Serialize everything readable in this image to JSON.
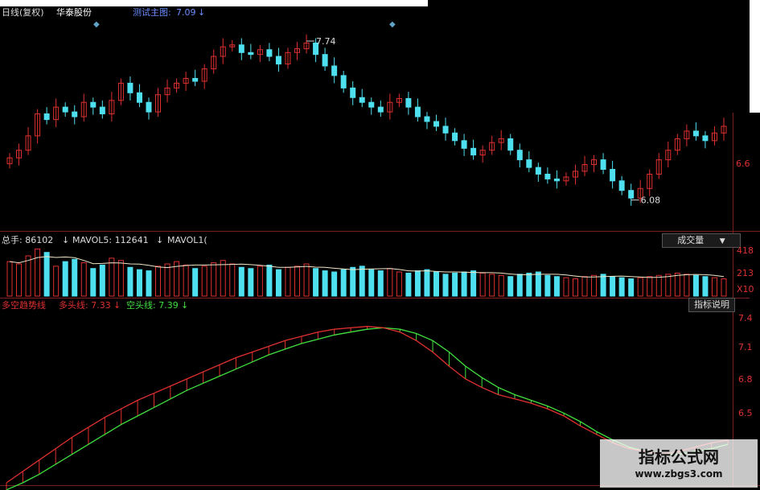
{
  "header": {
    "period": "日线(复权)",
    "stock": "华泰股份",
    "indicator_label": "测试主图:",
    "indicator_value": "7.09",
    "arrow": "↓"
  },
  "price_panel": {
    "high_label": "7.74",
    "low_label": "6.08",
    "right_axis": "6.6"
  },
  "volume_panel": {
    "vol_label": "总手: 86102",
    "mavol5_label": "MAVOL5: 112641",
    "mavol10_label": "MAVOL1(",
    "arrow": "↓",
    "selector": "成交量",
    "selector_caret": "▼",
    "axis": [
      "418",
      "213",
      "X10"
    ]
  },
  "indicator_panel": {
    "name": "多空趋势线",
    "long_label": "多头线: 7.33",
    "short_label": "空头线: 7.39",
    "arrow": "↓",
    "help_button": "指标说明",
    "axis": [
      "7.4",
      "7.1",
      "6.8",
      "6.5"
    ]
  },
  "watermark": {
    "line1": "指标公式网",
    "line2": "www.zbgs3.com"
  },
  "colors": {
    "up": "#e03030",
    "down": "#4fe0f0",
    "long_line": "#e03030",
    "short_line": "#40e040",
    "grid": "#7a1f1f"
  },
  "chart_data": [
    {
      "type": "candlestick",
      "title": "华泰股份 日线(复权)",
      "y_axis_label_printed": "6.6",
      "ylim": [
        5.9,
        7.9
      ],
      "annotations": [
        {
          "label": "7.74",
          "value": 7.74
        },
        {
          "label": "6.08",
          "value": 6.08
        }
      ],
      "close": [
        6.52,
        6.6,
        6.75,
        6.98,
        6.92,
        7.05,
        7.0,
        6.95,
        7.1,
        7.05,
        6.98,
        7.12,
        7.3,
        7.2,
        7.1,
        7.0,
        7.18,
        7.25,
        7.3,
        7.35,
        7.32,
        7.45,
        7.58,
        7.68,
        7.7,
        7.62,
        7.6,
        7.65,
        7.58,
        7.5,
        7.62,
        7.66,
        7.72,
        7.6,
        7.48,
        7.38,
        7.25,
        7.15,
        7.1,
        7.05,
        7.0,
        7.1,
        7.14,
        7.05,
        6.95,
        6.9,
        6.85,
        6.78,
        6.7,
        6.62,
        6.55,
        6.6,
        6.68,
        6.72,
        6.6,
        6.5,
        6.42,
        6.35,
        6.3,
        6.28,
        6.32,
        6.38,
        6.45,
        6.5,
        6.4,
        6.28,
        6.18,
        6.1,
        6.2,
        6.35,
        6.5,
        6.6,
        6.72,
        6.8,
        6.75,
        6.7,
        6.78,
        6.85
      ]
    },
    {
      "type": "bar",
      "title": "成交量",
      "series": [
        {
          "name": "总手",
          "last": 86102
        },
        {
          "name": "MAVOL5",
          "last": 112641
        }
      ],
      "axis_ticks_printed": [
        "418",
        "213",
        "X10"
      ],
      "values": [
        300,
        280,
        350,
        410,
        380,
        260,
        300,
        320,
        290,
        240,
        270,
        330,
        310,
        250,
        230,
        220,
        260,
        280,
        300,
        270,
        240,
        260,
        290,
        310,
        280,
        250,
        240,
        260,
        270,
        230,
        250,
        260,
        280,
        240,
        220,
        210,
        230,
        250,
        260,
        230,
        220,
        240,
        210,
        200,
        220,
        230,
        210,
        190,
        200,
        210,
        220,
        200,
        190,
        180,
        170,
        190,
        200,
        210,
        180,
        170,
        160,
        150,
        170,
        180,
        190,
        170,
        160,
        150,
        160,
        170,
        180,
        190,
        200,
        190,
        180,
        170,
        160,
        150
      ]
    },
    {
      "type": "line",
      "title": "多空趋势线",
      "ylim": [
        6.3,
        7.5
      ],
      "yticks": [
        7.4,
        7.1,
        6.8,
        6.5
      ],
      "series": [
        {
          "name": "多头线",
          "last": 7.33,
          "values": [
            6.3,
            6.38,
            6.46,
            6.54,
            6.62,
            6.69,
            6.76,
            6.82,
            6.88,
            6.93,
            6.98,
            7.03,
            7.08,
            7.13,
            7.18,
            7.22,
            7.26,
            7.3,
            7.33,
            7.36,
            7.38,
            7.39,
            7.4,
            7.39,
            7.36,
            7.3,
            7.22,
            7.12,
            7.03,
            6.97,
            6.92,
            6.89,
            6.86,
            6.82,
            6.77,
            6.7,
            6.64,
            6.58,
            6.54,
            6.52,
            6.5,
            6.52,
            6.55,
            6.58,
            6.6
          ]
        },
        {
          "name": "空头线",
          "last": 7.39,
          "values": [
            6.25,
            6.3,
            6.36,
            6.43,
            6.5,
            6.57,
            6.64,
            6.71,
            6.77,
            6.83,
            6.89,
            6.95,
            7.0,
            7.05,
            7.1,
            7.15,
            7.2,
            7.24,
            7.28,
            7.31,
            7.34,
            7.36,
            7.38,
            7.39,
            7.38,
            7.35,
            7.3,
            7.22,
            7.12,
            7.04,
            6.97,
            6.92,
            6.88,
            6.84,
            6.79,
            6.73,
            6.66,
            6.6,
            6.55,
            6.52,
            6.5,
            6.5,
            6.52,
            6.54,
            6.57
          ]
        }
      ]
    }
  ]
}
